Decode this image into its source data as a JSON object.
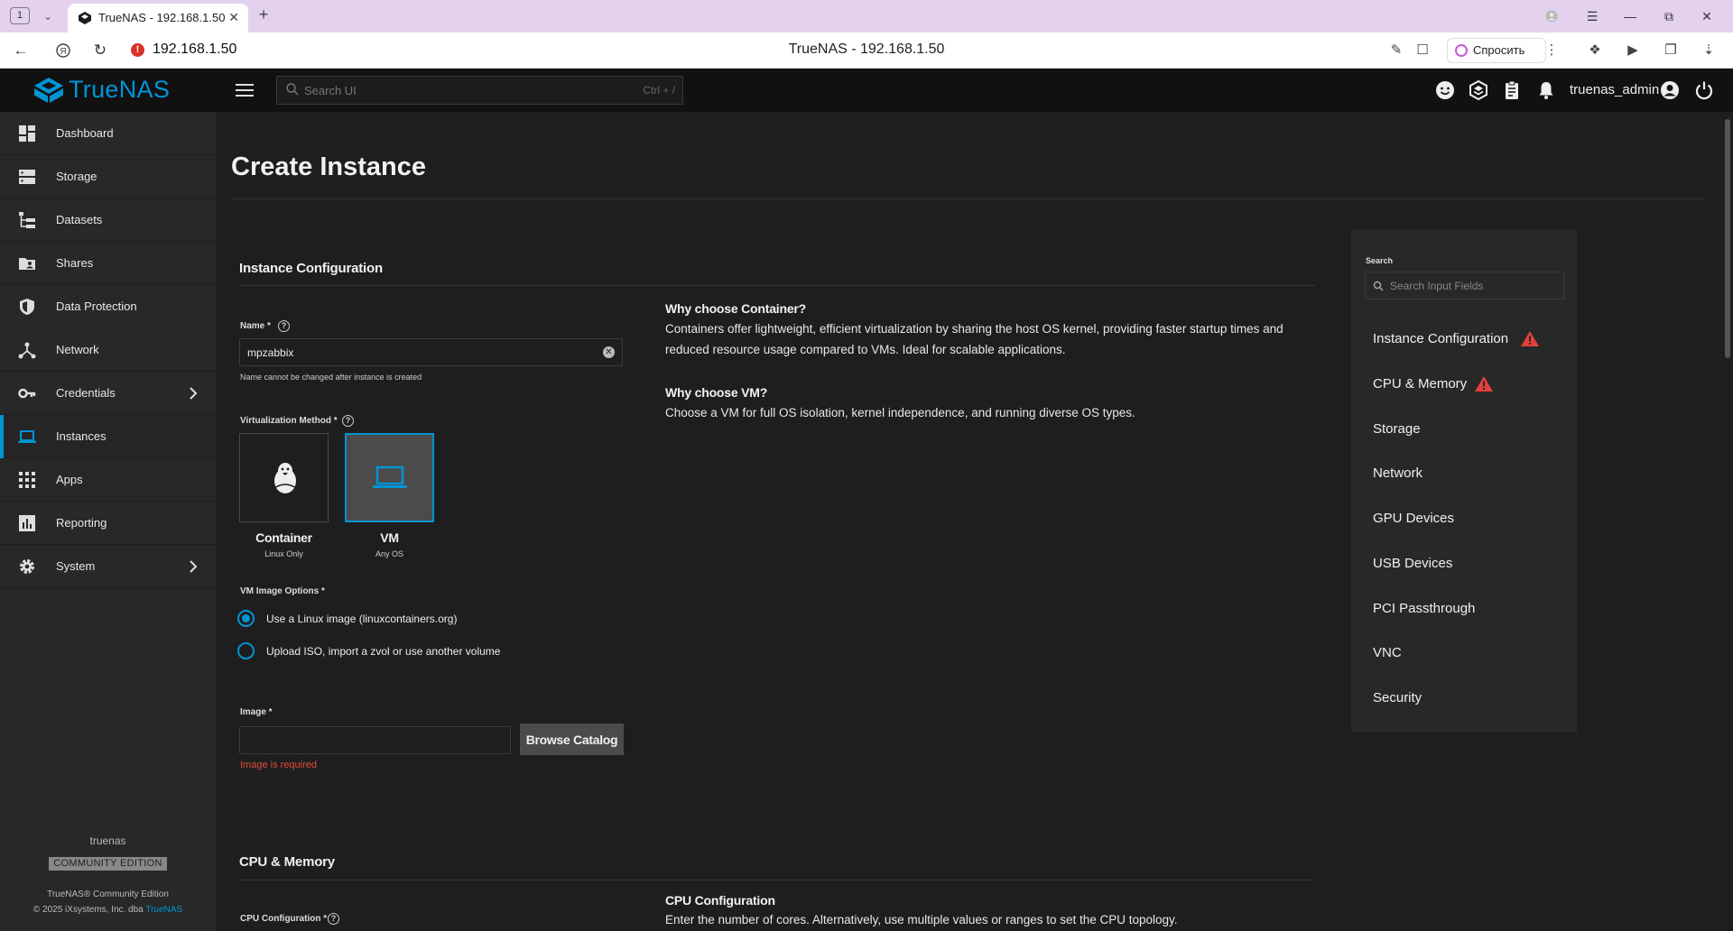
{
  "browser": {
    "tab_counter": "1",
    "tab_title": "TrueNAS - 192.168.1.50",
    "url": "192.168.1.50",
    "page_title": "TrueNAS - 192.168.1.50",
    "ask_label": "Спросить"
  },
  "topbar": {
    "logo_text": "TrueNAS",
    "search_placeholder": "Search UI",
    "search_shortcut": "Ctrl + /",
    "username": "truenas_admin"
  },
  "sidebar": {
    "items": [
      {
        "label": "Dashboard",
        "icon": "dashboard-icon"
      },
      {
        "label": "Storage",
        "icon": "storage-icon"
      },
      {
        "label": "Datasets",
        "icon": "datasets-icon"
      },
      {
        "label": "Shares",
        "icon": "shares-icon"
      },
      {
        "label": "Data Protection",
        "icon": "shield-icon"
      },
      {
        "label": "Network",
        "icon": "network-icon"
      },
      {
        "label": "Credentials",
        "icon": "key-icon"
      },
      {
        "label": "Instances",
        "icon": "laptop-icon",
        "active": true
      },
      {
        "label": "Apps",
        "icon": "apps-grid-icon"
      },
      {
        "label": "Reporting",
        "icon": "reporting-icon"
      },
      {
        "label": "System",
        "icon": "gear-icon"
      }
    ],
    "footer": {
      "hostname": "truenas",
      "edition_badge": "COMMUNITY EDITION",
      "product_line": "TrueNAS® Community Edition",
      "copyright_prefix": "© 2025 iXsystems, Inc. dba ",
      "copyright_link": "TrueNAS"
    }
  },
  "page": {
    "title": "Create Instance"
  },
  "instance_config": {
    "section_title": "Instance Configuration",
    "name_label": "Name *",
    "name_value": "mpzabbix",
    "name_hint": "Name cannot be changed after instance is created",
    "virt_label": "Virtualization Method *",
    "container_label": "Container",
    "container_sub": "Linux Only",
    "vm_label": "VM",
    "vm_sub": "Any OS",
    "vm_image_options_label": "VM Image Options *",
    "option_linux_image": "Use a Linux image (linuxcontainers.org)",
    "option_upload_iso": "Upload ISO, import a zvol or use another volume",
    "image_label": "Image *",
    "browse_catalog": "Browse Catalog",
    "image_error": "Image is required"
  },
  "help": {
    "container_heading": "Why choose Container?",
    "container_text": "Containers offer lightweight, efficient virtualization by sharing the host OS kernel, providing faster startup times and reduced resource usage compared to VMs. Ideal for scalable applications.",
    "vm_heading": "Why choose VM?",
    "vm_text": "Choose a VM for full OS isolation, kernel independence, and running diverse OS types.",
    "cpu_heading": "CPU Configuration",
    "cpu_text": "Enter the number of cores. Alternatively, use multiple values or ranges to set the CPU topology."
  },
  "cpu_memory": {
    "section_title": "CPU & Memory",
    "cpu_config_label": "CPU Configuration *"
  },
  "side_panel": {
    "search_label": "Search",
    "search_placeholder": "Search Input Fields",
    "links": [
      {
        "label": "Instance Configuration",
        "warning": true
      },
      {
        "label": "CPU & Memory",
        "warning": true
      },
      {
        "label": "Storage"
      },
      {
        "label": "Network"
      },
      {
        "label": "GPU Devices"
      },
      {
        "label": "USB Devices"
      },
      {
        "label": "PCI Passthrough"
      },
      {
        "label": "VNC"
      },
      {
        "label": "Security"
      }
    ]
  },
  "colors": {
    "accent": "#0095d5",
    "error": "#e54c3c",
    "warning": "#e0413a"
  }
}
